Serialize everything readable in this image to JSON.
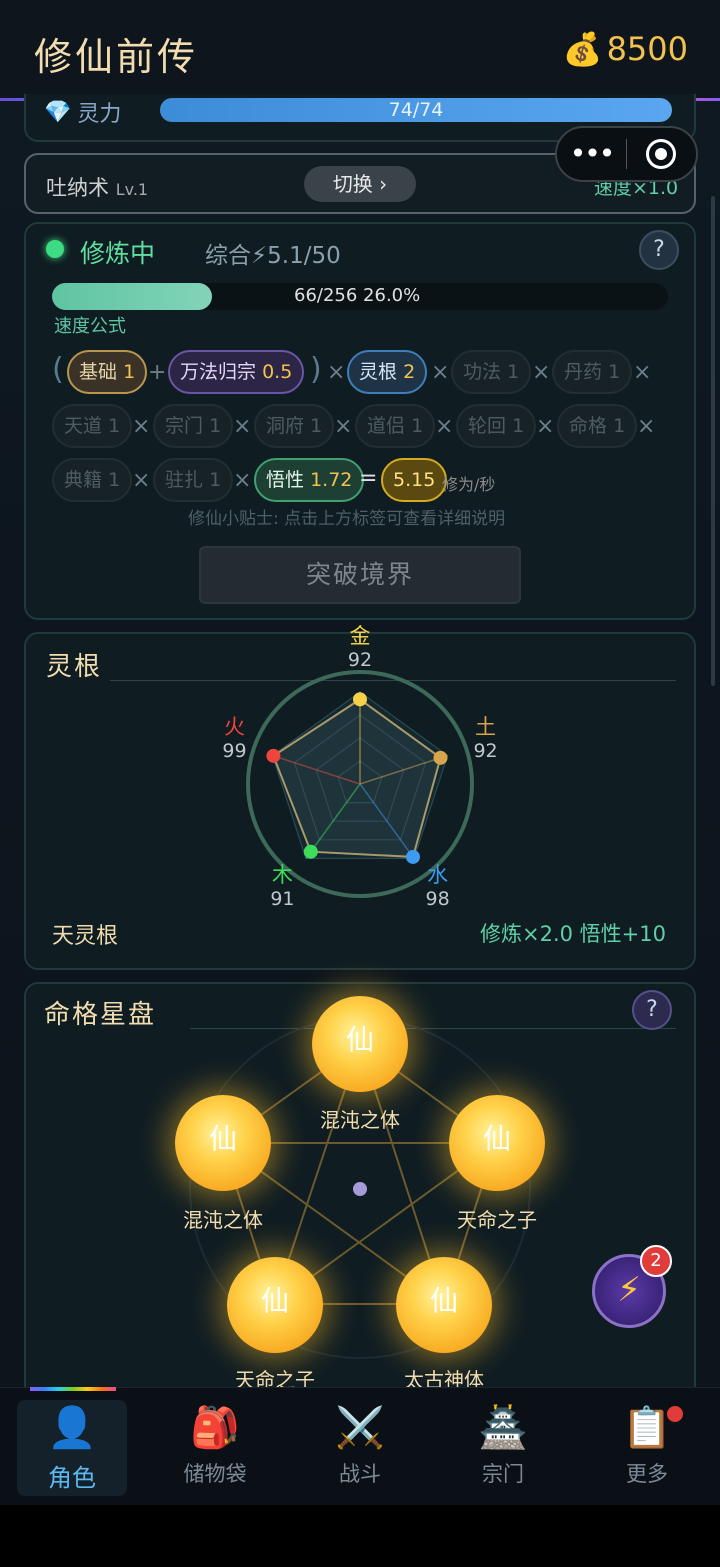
{
  "header": {
    "title": "修仙前传",
    "coin_icon": "money-bag-icon",
    "coins": "8500"
  },
  "spirit": {
    "label": "灵力",
    "icon": "diamond-icon",
    "value": "74/74",
    "fraction": 1.0
  },
  "technique": {
    "name": "吐纳术",
    "level": "Lv.1",
    "switch_label": "切换 ›",
    "speed": "速度×1.0"
  },
  "cultivation": {
    "status": "修炼中",
    "composite": "综合⚡5.1/50",
    "progress_text": "66/256  26.0%",
    "progress_fraction": 0.26,
    "formula_label": "速度公式",
    "chips": {
      "base": {
        "label": "基础",
        "value": "1"
      },
      "wanfa": {
        "label": "万法归宗",
        "value": "0.5"
      },
      "root": {
        "label": "灵根",
        "value": "2"
      },
      "gongfa": {
        "label": "功法",
        "value": "1"
      },
      "danyao": {
        "label": "丹药",
        "value": "1"
      },
      "tiandao": {
        "label": "天道",
        "value": "1"
      },
      "zongmen": {
        "label": "宗门",
        "value": "1"
      },
      "dongfu": {
        "label": "洞府",
        "value": "1"
      },
      "daolv": {
        "label": "道侣",
        "value": "1"
      },
      "lunhui": {
        "label": "轮回",
        "value": "1"
      },
      "mingge": {
        "label": "命格",
        "value": "1"
      },
      "dianji": {
        "label": "典籍",
        "value": "1"
      },
      "zhuzha": {
        "label": "驻扎",
        "value": "1"
      },
      "wuxing": {
        "label": "悟性",
        "value": "1.72"
      },
      "result": "5.15"
    },
    "rate_unit": "修为/秒",
    "tip": "修仙小贴士: 点击上方标签可查看详细说明",
    "breakthrough_label": "突破境界"
  },
  "spirit_root": {
    "title": "灵根",
    "elements": [
      {
        "name": "金",
        "value": "92",
        "color": "#f6d24a"
      },
      {
        "name": "土",
        "value": "92",
        "color": "#d9a54a"
      },
      {
        "name": "水",
        "value": "98",
        "color": "#3d9bf0"
      },
      {
        "name": "木",
        "value": "91",
        "color": "#3ddc5a"
      },
      {
        "name": "火",
        "value": "99",
        "color": "#f0453d"
      }
    ],
    "root_name": "天灵根",
    "bonus": "修炼×2.0  悟性+10"
  },
  "star_chart": {
    "title": "命格星盘",
    "orbs": [
      {
        "glyph": "仙",
        "name": "混沌之体"
      },
      {
        "glyph": "仙",
        "name": "混沌之体"
      },
      {
        "glyph": "仙",
        "name": "天命之子"
      },
      {
        "glyph": "仙",
        "name": "天命之子"
      },
      {
        "glyph": "仙",
        "name": "太古神体"
      }
    ]
  },
  "fab": {
    "badge": "2",
    "icon": "lightning-icon"
  },
  "tabs": [
    {
      "label": "角色",
      "icon": "person-icon",
      "active": true
    },
    {
      "label": "储物袋",
      "icon": "backpack-icon"
    },
    {
      "label": "战斗",
      "icon": "crossed-swords-icon"
    },
    {
      "label": "宗门",
      "icon": "pagoda-icon"
    },
    {
      "label": "更多",
      "icon": "clipboard-icon"
    }
  ]
}
